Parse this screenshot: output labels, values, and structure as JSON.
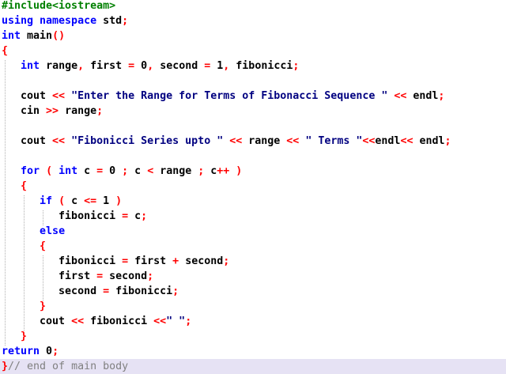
{
  "colors": {
    "preprocessor": "#008000",
    "keyword": "#0000ff",
    "operator": "#ff0000",
    "string": "#000080",
    "identifier": "#000000",
    "comment": "#808080",
    "current_line_highlight": "#e6e2f4",
    "background": "#ffffff"
  },
  "editor": {
    "current_line": 24,
    "lines": [
      [
        {
          "t": "pre",
          "s": "#include<iostream>"
        }
      ],
      [
        {
          "t": "kw",
          "s": "using namespace "
        },
        {
          "t": "id",
          "s": "std"
        },
        {
          "t": "op",
          "s": ";"
        }
      ],
      [
        {
          "t": "type",
          "s": "int "
        },
        {
          "t": "id",
          "s": "main"
        },
        {
          "t": "op",
          "s": "()"
        }
      ],
      [
        {
          "t": "op",
          "s": "{"
        }
      ],
      [
        {
          "t": "id",
          "s": "   "
        },
        {
          "t": "type",
          "s": "int "
        },
        {
          "t": "id",
          "s": "range"
        },
        {
          "t": "op",
          "s": ", "
        },
        {
          "t": "id",
          "s": "first "
        },
        {
          "t": "op",
          "s": "= "
        },
        {
          "t": "num",
          "s": "0"
        },
        {
          "t": "op",
          "s": ", "
        },
        {
          "t": "id",
          "s": "second "
        },
        {
          "t": "op",
          "s": "= "
        },
        {
          "t": "num",
          "s": "1"
        },
        {
          "t": "op",
          "s": ", "
        },
        {
          "t": "id",
          "s": "fibonicci"
        },
        {
          "t": "op",
          "s": ";"
        }
      ],
      [],
      [
        {
          "t": "id",
          "s": "   cout "
        },
        {
          "t": "op",
          "s": "<< "
        },
        {
          "t": "str",
          "s": "\"Enter the Range for Terms of Fibonacci Sequence \" "
        },
        {
          "t": "op",
          "s": "<< "
        },
        {
          "t": "id",
          "s": "endl"
        },
        {
          "t": "op",
          "s": ";"
        }
      ],
      [
        {
          "t": "id",
          "s": "   cin "
        },
        {
          "t": "op",
          "s": ">> "
        },
        {
          "t": "id",
          "s": "range"
        },
        {
          "t": "op",
          "s": ";"
        }
      ],
      [],
      [
        {
          "t": "id",
          "s": "   cout "
        },
        {
          "t": "op",
          "s": "<< "
        },
        {
          "t": "str",
          "s": "\"Fibonicci Series upto \" "
        },
        {
          "t": "op",
          "s": "<< "
        },
        {
          "t": "id",
          "s": "range "
        },
        {
          "t": "op",
          "s": "<< "
        },
        {
          "t": "str",
          "s": "\" Terms \""
        },
        {
          "t": "op",
          "s": "<<"
        },
        {
          "t": "id",
          "s": "endl"
        },
        {
          "t": "op",
          "s": "<< "
        },
        {
          "t": "id",
          "s": "endl"
        },
        {
          "t": "op",
          "s": ";"
        }
      ],
      [],
      [
        {
          "t": "id",
          "s": "   "
        },
        {
          "t": "kw",
          "s": "for "
        },
        {
          "t": "op",
          "s": "( "
        },
        {
          "t": "type",
          "s": "int "
        },
        {
          "t": "id",
          "s": "c "
        },
        {
          "t": "op",
          "s": "= "
        },
        {
          "t": "num",
          "s": "0 "
        },
        {
          "t": "op",
          "s": "; "
        },
        {
          "t": "id",
          "s": "c "
        },
        {
          "t": "op",
          "s": "< "
        },
        {
          "t": "id",
          "s": "range "
        },
        {
          "t": "op",
          "s": "; "
        },
        {
          "t": "id",
          "s": "c"
        },
        {
          "t": "op",
          "s": "++ )"
        }
      ],
      [
        {
          "t": "id",
          "s": "   "
        },
        {
          "t": "op",
          "s": "{"
        }
      ],
      [
        {
          "t": "id",
          "s": "      "
        },
        {
          "t": "kw",
          "s": "if "
        },
        {
          "t": "op",
          "s": "( "
        },
        {
          "t": "id",
          "s": "c "
        },
        {
          "t": "op",
          "s": "<= "
        },
        {
          "t": "num",
          "s": "1 "
        },
        {
          "t": "op",
          "s": ")"
        }
      ],
      [
        {
          "t": "id",
          "s": "         fibonicci "
        },
        {
          "t": "op",
          "s": "= "
        },
        {
          "t": "id",
          "s": "c"
        },
        {
          "t": "op",
          "s": ";"
        }
      ],
      [
        {
          "t": "id",
          "s": "      "
        },
        {
          "t": "kw",
          "s": "else"
        }
      ],
      [
        {
          "t": "id",
          "s": "      "
        },
        {
          "t": "op",
          "s": "{"
        }
      ],
      [
        {
          "t": "id",
          "s": "         fibonicci "
        },
        {
          "t": "op",
          "s": "= "
        },
        {
          "t": "id",
          "s": "first "
        },
        {
          "t": "op",
          "s": "+ "
        },
        {
          "t": "id",
          "s": "second"
        },
        {
          "t": "op",
          "s": ";"
        }
      ],
      [
        {
          "t": "id",
          "s": "         first "
        },
        {
          "t": "op",
          "s": "= "
        },
        {
          "t": "id",
          "s": "second"
        },
        {
          "t": "op",
          "s": ";"
        }
      ],
      [
        {
          "t": "id",
          "s": "         second "
        },
        {
          "t": "op",
          "s": "= "
        },
        {
          "t": "id",
          "s": "fibonicci"
        },
        {
          "t": "op",
          "s": ";"
        }
      ],
      [
        {
          "t": "id",
          "s": "      "
        },
        {
          "t": "op",
          "s": "}"
        }
      ],
      [
        {
          "t": "id",
          "s": "      cout "
        },
        {
          "t": "op",
          "s": "<< "
        },
        {
          "t": "id",
          "s": "fibonicci "
        },
        {
          "t": "op",
          "s": "<<"
        },
        {
          "t": "str",
          "s": "\" \""
        },
        {
          "t": "op",
          "s": ";"
        }
      ],
      [
        {
          "t": "id",
          "s": "   "
        },
        {
          "t": "op",
          "s": "}"
        }
      ],
      [
        {
          "t": "kw",
          "s": "return "
        },
        {
          "t": "num",
          "s": "0"
        },
        {
          "t": "op",
          "s": ";"
        }
      ],
      [
        {
          "t": "op",
          "s": "}"
        },
        {
          "t": "cmt",
          "s": "// end of main body"
        }
      ]
    ]
  }
}
